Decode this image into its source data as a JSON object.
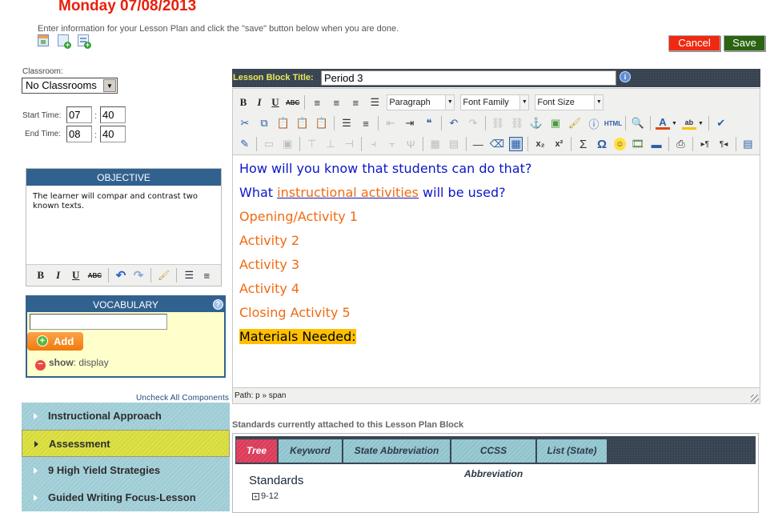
{
  "header": {
    "title": "Monday 07/08/2013",
    "instructions": "Enter information for your Lesson Plan and click the \"save\" button below when you are done.",
    "icons": [
      "calendar-icon",
      "add-document-icon",
      "add-form-icon"
    ],
    "cancel_label": "Cancel",
    "save_label": "Save"
  },
  "form": {
    "classroom_label": "Classroom:",
    "classroom_value": "No Classrooms",
    "start_label": "Start Time:",
    "end_label": "End Time:",
    "start_hour": "07",
    "start_minute": "40",
    "end_hour": "08",
    "end_minute": "40",
    "colon": ":"
  },
  "objective": {
    "title": "OBJECTIVE",
    "text": "The learner will compar and contrast two known texts.",
    "toolbar": [
      "B",
      "I",
      "U",
      "ABC",
      "undo",
      "redo",
      "cleanup",
      "bullet-list",
      "numbered-list"
    ]
  },
  "vocabulary": {
    "title": "VOCABULARY",
    "input_value": "",
    "add_label": "Add",
    "show_label": "show",
    "show_value": ": display"
  },
  "components": {
    "uncheck_all_label": "Uncheck All Components",
    "items": [
      {
        "label": "Instructional Approach",
        "active": false
      },
      {
        "label": "Assessment",
        "active": true
      },
      {
        "label": "9 High Yield Strategies",
        "active": false
      },
      {
        "label": "Guided Writing Focus-Lesson",
        "active": false
      }
    ]
  },
  "lesson_block": {
    "title_label": "Lesson Block Title:",
    "title_value": "Period 3"
  },
  "editor": {
    "format_value": "Paragraph",
    "font_family_value": "Font Family",
    "font_size_value": "Font Size",
    "html_label": "HTML",
    "content": {
      "line1": "How will you know that students can do that?",
      "line2_pre": "What ",
      "line2_link": "instructional activities",
      "line2_post": " will be used?",
      "line3": "Opening/Activity 1",
      "line4": "Activity 2",
      "line5": "Activity 3",
      "line6": "Activity 4",
      "line7": "Closing Activity 5",
      "line8": "Materials Needed:"
    },
    "path": "Path: p » span",
    "colors": {
      "question": "#0b16c8",
      "activity": "#f06a10",
      "highlight": "#ffc000"
    }
  },
  "standards": {
    "caption": "Standards currently attached to this Lesson Plan Block",
    "tabs": [
      {
        "label": "Tree",
        "active": true
      },
      {
        "label": "Keyword",
        "active": false
      },
      {
        "label": "State Abbreviation",
        "active": false
      },
      {
        "label": "CCSS Abbreviation",
        "active": false
      },
      {
        "label": "List (State)",
        "active": false
      }
    ],
    "heading": "Standards",
    "tree_node": "9-12"
  }
}
